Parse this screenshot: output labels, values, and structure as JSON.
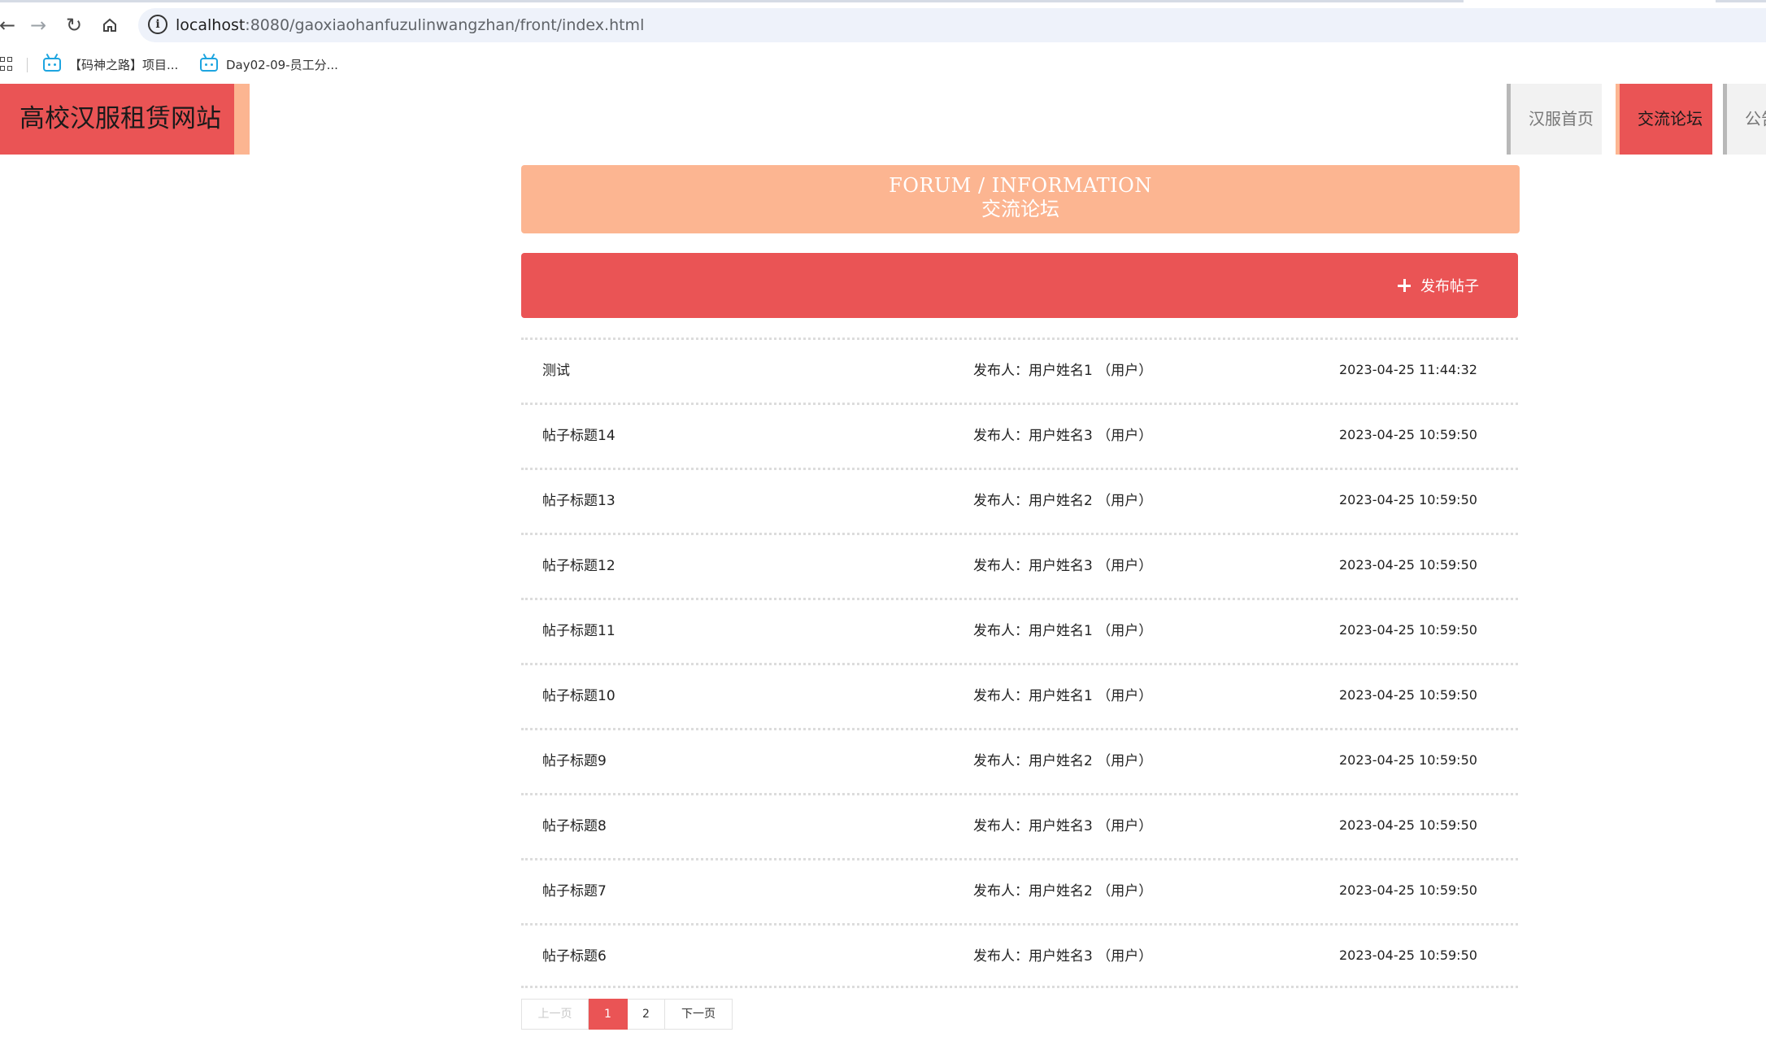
{
  "browser": {
    "url_host": "localhost",
    "url_rest": ":8080/gaoxiaohanfuzulinwangzhan/front/index.html",
    "bookmarks": [
      {
        "label": "【码神之路】项目..."
      },
      {
        "label": "Day02-09-员工分..."
      }
    ]
  },
  "site": {
    "logo": "高校汉服租赁网站",
    "nav": [
      {
        "label": "汉服首页"
      },
      {
        "label": "交流论坛"
      },
      {
        "label": "公告"
      }
    ]
  },
  "banner": {
    "title_en": "FORUM / INFORMATION",
    "title_cn": "交流论坛"
  },
  "actions": {
    "publish": "发布帖子"
  },
  "posts": [
    {
      "title": "测试",
      "author": "发布人：用户姓名1 （用户）",
      "time": "2023-04-25 11:44:32"
    },
    {
      "title": "帖子标题14",
      "author": "发布人：用户姓名3 （用户）",
      "time": "2023-04-25 10:59:50"
    },
    {
      "title": "帖子标题13",
      "author": "发布人：用户姓名2 （用户）",
      "time": "2023-04-25 10:59:50"
    },
    {
      "title": "帖子标题12",
      "author": "发布人：用户姓名3 （用户）",
      "time": "2023-04-25 10:59:50"
    },
    {
      "title": "帖子标题11",
      "author": "发布人：用户姓名1 （用户）",
      "time": "2023-04-25 10:59:50"
    },
    {
      "title": "帖子标题10",
      "author": "发布人：用户姓名1 （用户）",
      "time": "2023-04-25 10:59:50"
    },
    {
      "title": "帖子标题9",
      "author": "发布人：用户姓名2 （用户）",
      "time": "2023-04-25 10:59:50"
    },
    {
      "title": "帖子标题8",
      "author": "发布人：用户姓名3 （用户）",
      "time": "2023-04-25 10:59:50"
    },
    {
      "title": "帖子标题7",
      "author": "发布人：用户姓名2 （用户）",
      "time": "2023-04-25 10:59:50"
    },
    {
      "title": "帖子标题6",
      "author": "发布人：用户姓名3 （用户）",
      "time": "2023-04-25 10:59:50"
    }
  ],
  "pagination": {
    "prev": "上一页",
    "pages": [
      "1",
      "2"
    ],
    "current": "1",
    "next": "下一页"
  },
  "colors": {
    "primary": "#ea5455",
    "accent": "#fcb591"
  }
}
